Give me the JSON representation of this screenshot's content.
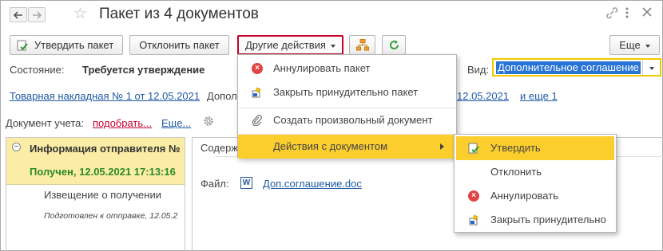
{
  "window": {
    "title": "Пакет из 4 документов"
  },
  "toolbar": {
    "approve": "Утвердить пакет",
    "reject": "Отклонить пакет",
    "other": "Другие действия",
    "more": "Еще"
  },
  "status": {
    "label": "Состояние:",
    "value": "Требуется утверждение"
  },
  "kind": {
    "label": "Вид:",
    "value": "Дополнительное соглашение"
  },
  "links": {
    "waybill": "Товарная накладная № 1 от 12.05.2021",
    "partial": "Допол",
    "date_link": "12.05.2021",
    "and_more": "и еще 1"
  },
  "accounting": {
    "label": "Документ учета:",
    "pick": "подобрать...",
    "more": "Еще..."
  },
  "left_panel": {
    "header": "Информация отправителя №",
    "received": "Получен, 12.05.2021 17:13:16",
    "notice": "Извещение о получении",
    "prepared": "Подготовлен к отправке, 12.05.2"
  },
  "right_panel": {
    "tab_partial": "Содерж",
    "file_label": "Файл:",
    "file_name": "Доп.соглашение.doc"
  },
  "menu": {
    "items": [
      {
        "label": "Аннулировать пакет",
        "icon": "cancel-icon"
      },
      {
        "label": "Закрыть принудительно пакет",
        "icon": "force-close-icon"
      },
      {
        "label": "Создать произвольный документ",
        "icon": "paperclip-icon"
      },
      {
        "label": "Действия с документом",
        "icon": ""
      }
    ]
  },
  "submenu": {
    "items": [
      {
        "label": "Утвердить",
        "icon": "approve-doc-icon"
      },
      {
        "label": "Отклонить",
        "icon": ""
      },
      {
        "label": "Аннулировать",
        "icon": "cancel-icon"
      },
      {
        "label": "Закрыть принудительно",
        "icon": "force-close-icon"
      }
    ]
  },
  "colors": {
    "highlight": "#fbce2e",
    "link": "#1f5aa6",
    "accent_red": "#c7002c",
    "panel_yellow": "#fbeda5",
    "received_green": "#2b8a2b"
  }
}
